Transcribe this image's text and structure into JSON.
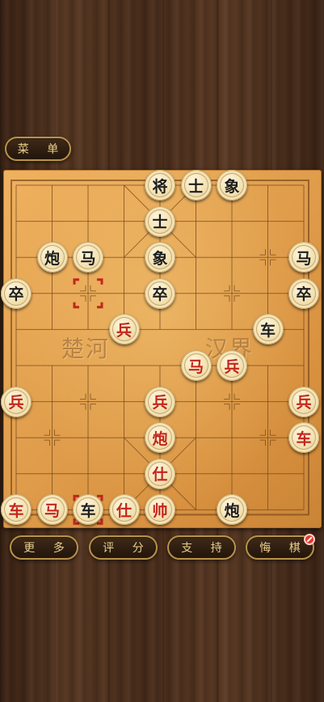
{
  "menu_label": "菜 单",
  "river": {
    "left_text": "楚河",
    "right_text": "汉界"
  },
  "buttons": {
    "more": "更 多",
    "score": "评 分",
    "support": "支 持",
    "undo": "悔 棋"
  },
  "undo_status_icon": "no-entry-icon",
  "colors": {
    "red_piece_text": "#c3261c",
    "black_piece_text": "#1e1e1e",
    "board": "#e2a04e",
    "button_text": "#e9cf8a"
  },
  "pieces": [
    {
      "label": "将",
      "side": "black",
      "col": 4,
      "row": 0
    },
    {
      "label": "士",
      "side": "black",
      "col": 5,
      "row": 0
    },
    {
      "label": "象",
      "side": "black",
      "col": 6,
      "row": 0
    },
    {
      "label": "士",
      "side": "black",
      "col": 4,
      "row": 1
    },
    {
      "label": "炮",
      "side": "black",
      "col": 1,
      "row": 2
    },
    {
      "label": "马",
      "side": "black",
      "col": 2,
      "row": 2
    },
    {
      "label": "象",
      "side": "black",
      "col": 4,
      "row": 2
    },
    {
      "label": "马",
      "side": "black",
      "col": 8,
      "row": 2
    },
    {
      "label": "卒",
      "side": "black",
      "col": 0,
      "row": 3
    },
    {
      "label": "卒",
      "side": "black",
      "col": 4,
      "row": 3
    },
    {
      "label": "卒",
      "side": "black",
      "col": 8,
      "row": 3
    },
    {
      "label": "兵",
      "side": "red",
      "col": 3,
      "row": 4
    },
    {
      "label": "车",
      "side": "black",
      "col": 7,
      "row": 4
    },
    {
      "label": "马",
      "side": "red",
      "col": 5,
      "row": 5
    },
    {
      "label": "兵",
      "side": "red",
      "col": 6,
      "row": 5
    },
    {
      "label": "兵",
      "side": "red",
      "col": 0,
      "row": 6
    },
    {
      "label": "兵",
      "side": "red",
      "col": 4,
      "row": 6
    },
    {
      "label": "兵",
      "side": "red",
      "col": 8,
      "row": 6
    },
    {
      "label": "炮",
      "side": "red",
      "col": 4,
      "row": 7
    },
    {
      "label": "车",
      "side": "red",
      "col": 8,
      "row": 7
    },
    {
      "label": "仕",
      "side": "red",
      "col": 4,
      "row": 8
    },
    {
      "label": "车",
      "side": "red",
      "col": 0,
      "row": 9
    },
    {
      "label": "马",
      "side": "red",
      "col": 1,
      "row": 9
    },
    {
      "label": "车",
      "side": "black",
      "col": 2,
      "row": 9
    },
    {
      "label": "仕",
      "side": "red",
      "col": 3,
      "row": 9
    },
    {
      "label": "帅",
      "side": "red",
      "col": 4,
      "row": 9
    },
    {
      "label": "炮",
      "side": "black",
      "col": 6,
      "row": 9
    }
  ],
  "last_move_markers": [
    {
      "col": 2,
      "row": 3
    },
    {
      "col": 2,
      "row": 9
    }
  ]
}
